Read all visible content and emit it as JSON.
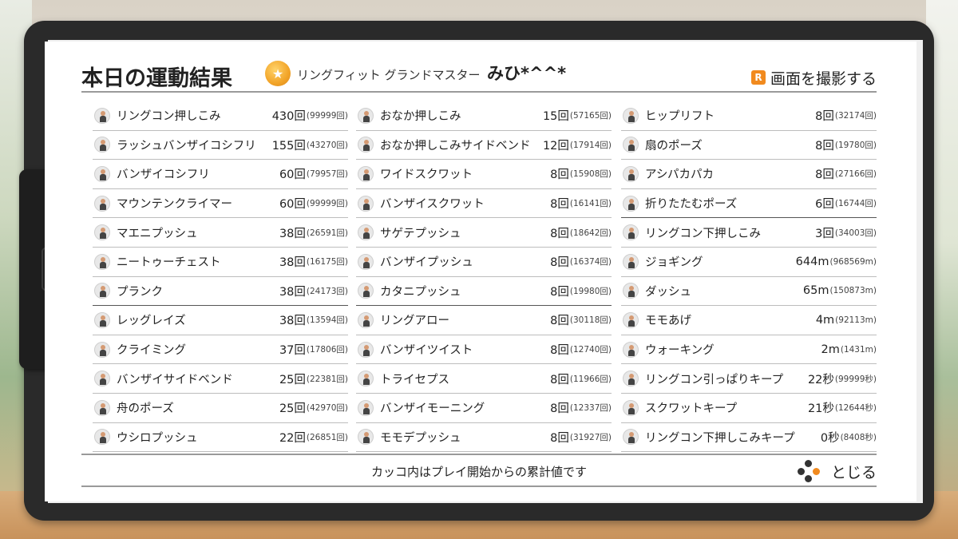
{
  "header": {
    "title": "本日の運動結果",
    "rank": "リングフィット グランドマスター",
    "player": "みひ*^^*",
    "screenshot_key": "R",
    "screenshot_label": "画面を撮影する"
  },
  "columns": [
    [
      {
        "name": "リングコン押しこみ",
        "value": "430回",
        "total": "(99999回)"
      },
      {
        "name": "ラッシュバンザイコシフリ",
        "value": "155回",
        "total": "(43270回)"
      },
      {
        "name": "バンザイコシフリ",
        "value": "60回",
        "total": "(79957回)"
      },
      {
        "name": "マウンテンクライマー",
        "value": "60回",
        "total": "(99999回)"
      },
      {
        "name": "マエニプッシュ",
        "value": "38回",
        "total": "(26591回)"
      },
      {
        "name": "ニートゥーチェスト",
        "value": "38回",
        "total": "(16175回)"
      },
      {
        "name": "プランク",
        "value": "38回",
        "total": "(24173回)"
      },
      {
        "name": "レッグレイズ",
        "value": "38回",
        "total": "(13594回)"
      },
      {
        "name": "クライミング",
        "value": "37回",
        "total": "(17806回)"
      },
      {
        "name": "バンザイサイドベンド",
        "value": "25回",
        "total": "(22381回)"
      },
      {
        "name": "舟のポーズ",
        "value": "25回",
        "total": "(42970回)"
      },
      {
        "name": "ウシロプッシュ",
        "value": "22回",
        "total": "(26851回)"
      }
    ],
    [
      {
        "name": "おなか押しこみ",
        "value": "15回",
        "total": "(57165回)"
      },
      {
        "name": "おなか押しこみサイドベンド",
        "value": "12回",
        "total": "(17914回)"
      },
      {
        "name": "ワイドスクワット",
        "value": "8回",
        "total": "(15908回)"
      },
      {
        "name": "バンザイスクワット",
        "value": "8回",
        "total": "(16141回)"
      },
      {
        "name": "サゲテプッシュ",
        "value": "8回",
        "total": "(18642回)"
      },
      {
        "name": "バンザイプッシュ",
        "value": "8回",
        "total": "(16374回)"
      },
      {
        "name": "カタニプッシュ",
        "value": "8回",
        "total": "(19980回)"
      },
      {
        "name": "リングアロー",
        "value": "8回",
        "total": "(30118回)"
      },
      {
        "name": "バンザイツイスト",
        "value": "8回",
        "total": "(12740回)"
      },
      {
        "name": "トライセプス",
        "value": "8回",
        "total": "(11966回)"
      },
      {
        "name": "バンザイモーニング",
        "value": "8回",
        "total": "(12337回)"
      },
      {
        "name": "モモデプッシュ",
        "value": "8回",
        "total": "(31927回)"
      }
    ],
    [
      {
        "name": "ヒップリフト",
        "value": "8回",
        "total": "(32174回)"
      },
      {
        "name": "扇のポーズ",
        "value": "8回",
        "total": "(19780回)"
      },
      {
        "name": "アシパカパカ",
        "value": "8回",
        "total": "(27166回)"
      },
      {
        "name": "折りたたむポーズ",
        "value": "6回",
        "total": "(16744回)"
      },
      {
        "name": "リングコン下押しこみ",
        "value": "3回",
        "total": "(34003回)"
      },
      {
        "name": "ジョギング",
        "value": "644m",
        "total": "(968569m)"
      },
      {
        "name": "ダッシュ",
        "value": "65m",
        "total": "(150873m)"
      },
      {
        "name": "モモあげ",
        "value": "4m",
        "total": "(92113m)"
      },
      {
        "name": "ウォーキング",
        "value": "2m",
        "total": "(1431m)"
      },
      {
        "name": "リングコン引っぱりキープ",
        "value": "22秒",
        "total": "(99999秒)"
      },
      {
        "name": "スクワットキープ",
        "value": "21秒",
        "total": "(12644秒)"
      },
      {
        "name": "リングコン下押しこみキープ",
        "value": "0秒",
        "total": "(8408秒)"
      }
    ]
  ],
  "footer": {
    "note": "カッコ内はプレイ開始からの累計値です",
    "close_label": "とじる"
  },
  "colors": {
    "accent": "#f18a1e",
    "frame": "#2a2a2a",
    "paper": "#ffffff",
    "text": "#222222"
  },
  "icons": {
    "rank": "rank-medal-icon",
    "screenshot": "r-button-icon",
    "close": "button-cluster-icon"
  }
}
